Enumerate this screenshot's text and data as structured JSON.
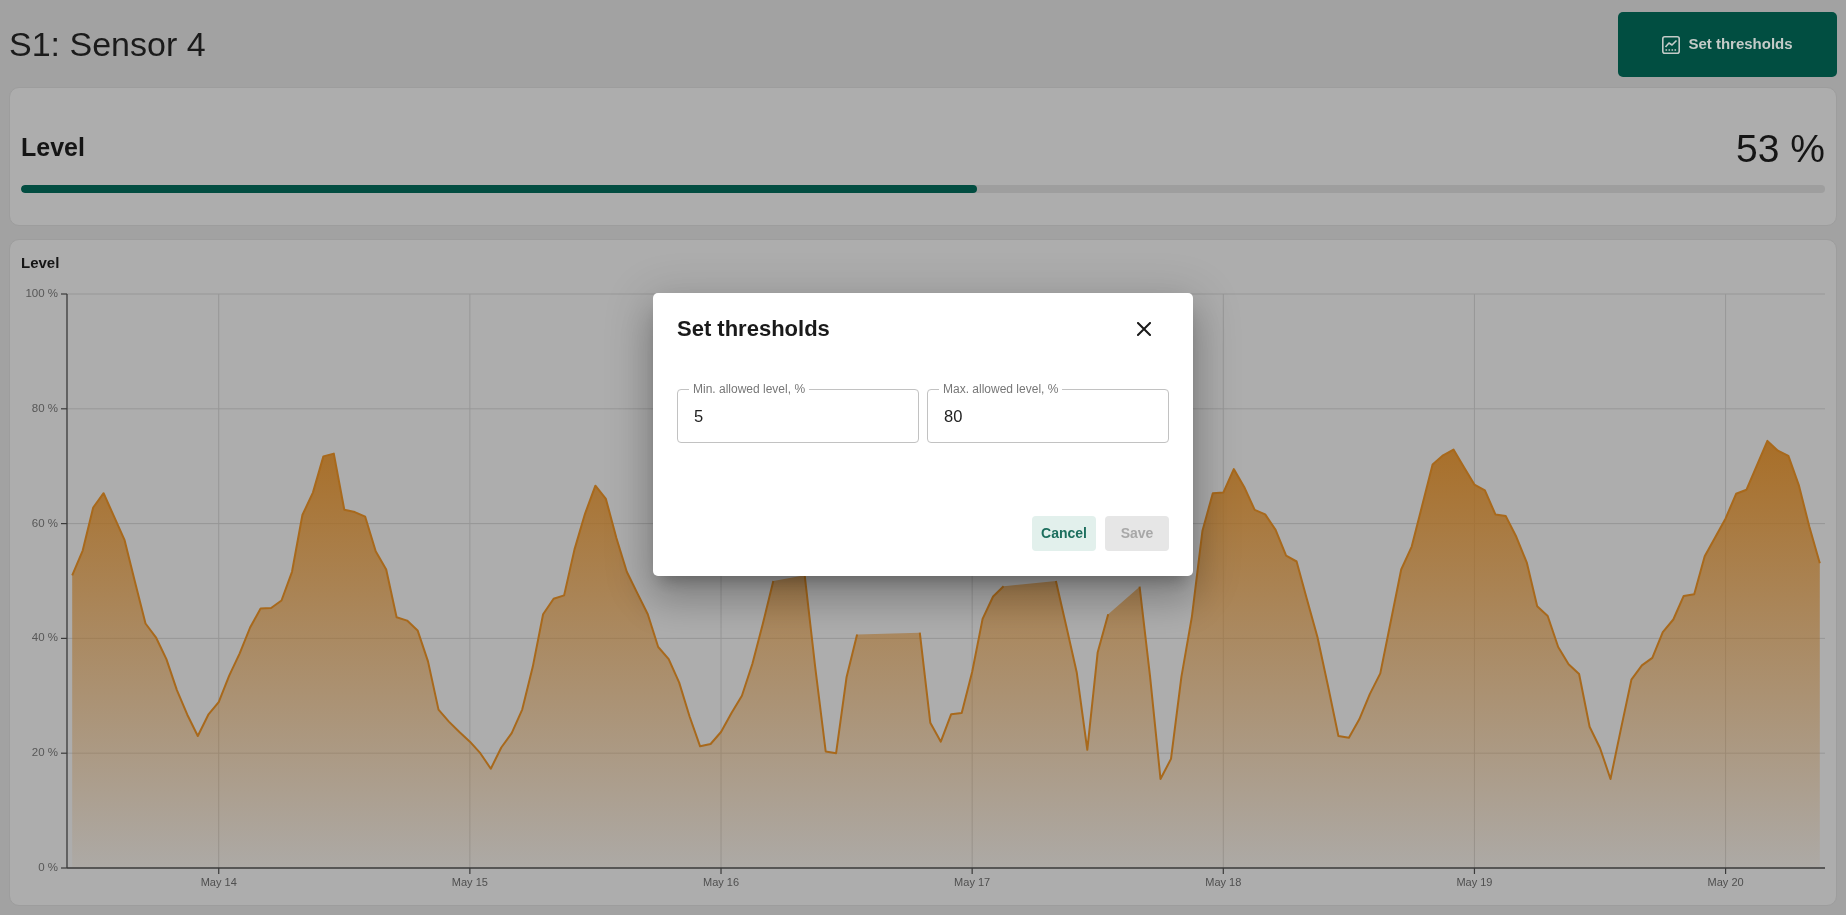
{
  "header": {
    "title": "S1: Sensor 4",
    "button": {
      "label": "Set thresholds"
    }
  },
  "level_card": {
    "label": "Level",
    "reading": "53 %",
    "level": 0.53
  },
  "chart_card": {
    "chart_data": {
      "type": "area",
      "title": "Level",
      "grid": true,
      "categories": [
        null,
        null,
        null,
        null,
        null,
        null,
        null,
        null,
        null,
        null,
        null,
        null,
        null,
        null,
        "May 14",
        null,
        null,
        null,
        null,
        null,
        null,
        null,
        null,
        null,
        null,
        null,
        null,
        null,
        null,
        null,
        null,
        null,
        null,
        null,
        null,
        null,
        null,
        null,
        "May 15",
        null,
        null,
        null,
        null,
        null,
        null,
        null,
        null,
        null,
        null,
        null,
        null,
        null,
        null,
        null,
        null,
        null,
        null,
        null,
        null,
        null,
        null,
        null,
        "May 16",
        null,
        null,
        null,
        null,
        null,
        null,
        null,
        null,
        null,
        null,
        null,
        null,
        null,
        null,
        null,
        null,
        null,
        null,
        null,
        null,
        null,
        null,
        null,
        "May 17",
        null,
        null,
        null,
        null,
        null,
        null,
        null,
        null,
        null,
        null,
        null,
        null,
        null,
        null,
        null,
        null,
        null,
        null,
        null,
        null,
        null,
        null,
        null,
        "May 18",
        null,
        null,
        null,
        null,
        null,
        null,
        null,
        null,
        null,
        null,
        null,
        null,
        null,
        null,
        null,
        null,
        null,
        null,
        null,
        null,
        null,
        null,
        null,
        "May 19",
        null,
        null,
        null,
        null,
        null,
        null,
        null,
        null,
        null,
        null,
        null,
        null,
        null,
        null,
        null,
        null,
        null,
        null,
        null,
        null,
        null,
        null,
        null,
        "May 20",
        null,
        null,
        null,
        null,
        null,
        null,
        null,
        null,
        null
      ],
      "series": [
        {
          "color": "#a8691c",
          "values": [
            51.0,
            55.3,
            62.8,
            65.3,
            61.2,
            57.1,
            49.8,
            42.6,
            40.2,
            36.4,
            31.0,
            26.7,
            23.0,
            26.7,
            28.9,
            33.5,
            37.4,
            41.9,
            45.2,
            45.3,
            46.6,
            51.6,
            61.5,
            65.4,
            71.7,
            72.2,
            62.4,
            62.0,
            61.2,
            55.2,
            52.0,
            43.7,
            43.1,
            41.4,
            36.0,
            27.6,
            25.5,
            23.7,
            22.0,
            20.0,
            17.3,
            21.0,
            23.5,
            27.6,
            35.0,
            44.2,
            46.9,
            47.5,
            55.5,
            61.7,
            66.6,
            64.3,
            57.5,
            51.6,
            47.9,
            44.2,
            38.5,
            36.4,
            32.3,
            26.4,
            21.2,
            21.6,
            23.7,
            27.0,
            30.0,
            35.6,
            42.6,
            50.0,
            null,
            null,
            51.0,
            35.0,
            20.3,
            20.0,
            33.3,
            40.7,
            null,
            null,
            null,
            null,
            null,
            41.0,
            25.3,
            22.0,
            26.8,
            27.0,
            34.2,
            43.4,
            47.3,
            49.1,
            null,
            null,
            null,
            null,
            50.0,
            42.1,
            34.0,
            20.6,
            37.6,
            44.2,
            null,
            null,
            49.0,
            33.3,
            15.5,
            19.0,
            33.3,
            43.8,
            58.7,
            65.3,
            65.4,
            69.5,
            66.4,
            62.4,
            61.6,
            58.9,
            54.4,
            53.4,
            46.8,
            40.2,
            31.8,
            23.0,
            22.7,
            25.9,
            30.3,
            33.9,
            42.9,
            52.0,
            56.0,
            63.1,
            70.3,
            71.9,
            72.9,
            69.8,
            66.8,
            65.8,
            61.6,
            61.3,
            57.7,
            53.2,
            45.6,
            43.9,
            38.5,
            35.5,
            33.8,
            24.6,
            20.9,
            15.5,
            24.2,
            32.8,
            35.3,
            36.6,
            41.1,
            43.3,
            47.4,
            47.7,
            54.3,
            57.6,
            60.9,
            65.2,
            65.9,
            70.2,
            74.4,
            72.7,
            71.8,
            66.7,
            59.5,
            53.1
          ]
        }
      ],
      "ylim": [
        0,
        100
      ],
      "yticks": [
        {
          "value": 0,
          "label": "0 %"
        },
        {
          "value": 20,
          "label": "20 %"
        },
        {
          "value": 40,
          "label": "40 %"
        },
        {
          "value": 60,
          "label": "60 %"
        },
        {
          "value": 80,
          "label": "80 %"
        },
        {
          "value": 100,
          "label": "100 %"
        }
      ]
    }
  },
  "dialog": {
    "title": "Set thresholds",
    "fields": [
      {
        "label": "Min. allowed level, %",
        "value": "5"
      },
      {
        "label": "Max. allowed level, %",
        "value": "80"
      }
    ],
    "buttons": [
      {
        "label": "Cancel",
        "kind": "tonal",
        "disabled": false
      },
      {
        "label": "Save",
        "kind": "filled",
        "disabled": true
      }
    ]
  }
}
